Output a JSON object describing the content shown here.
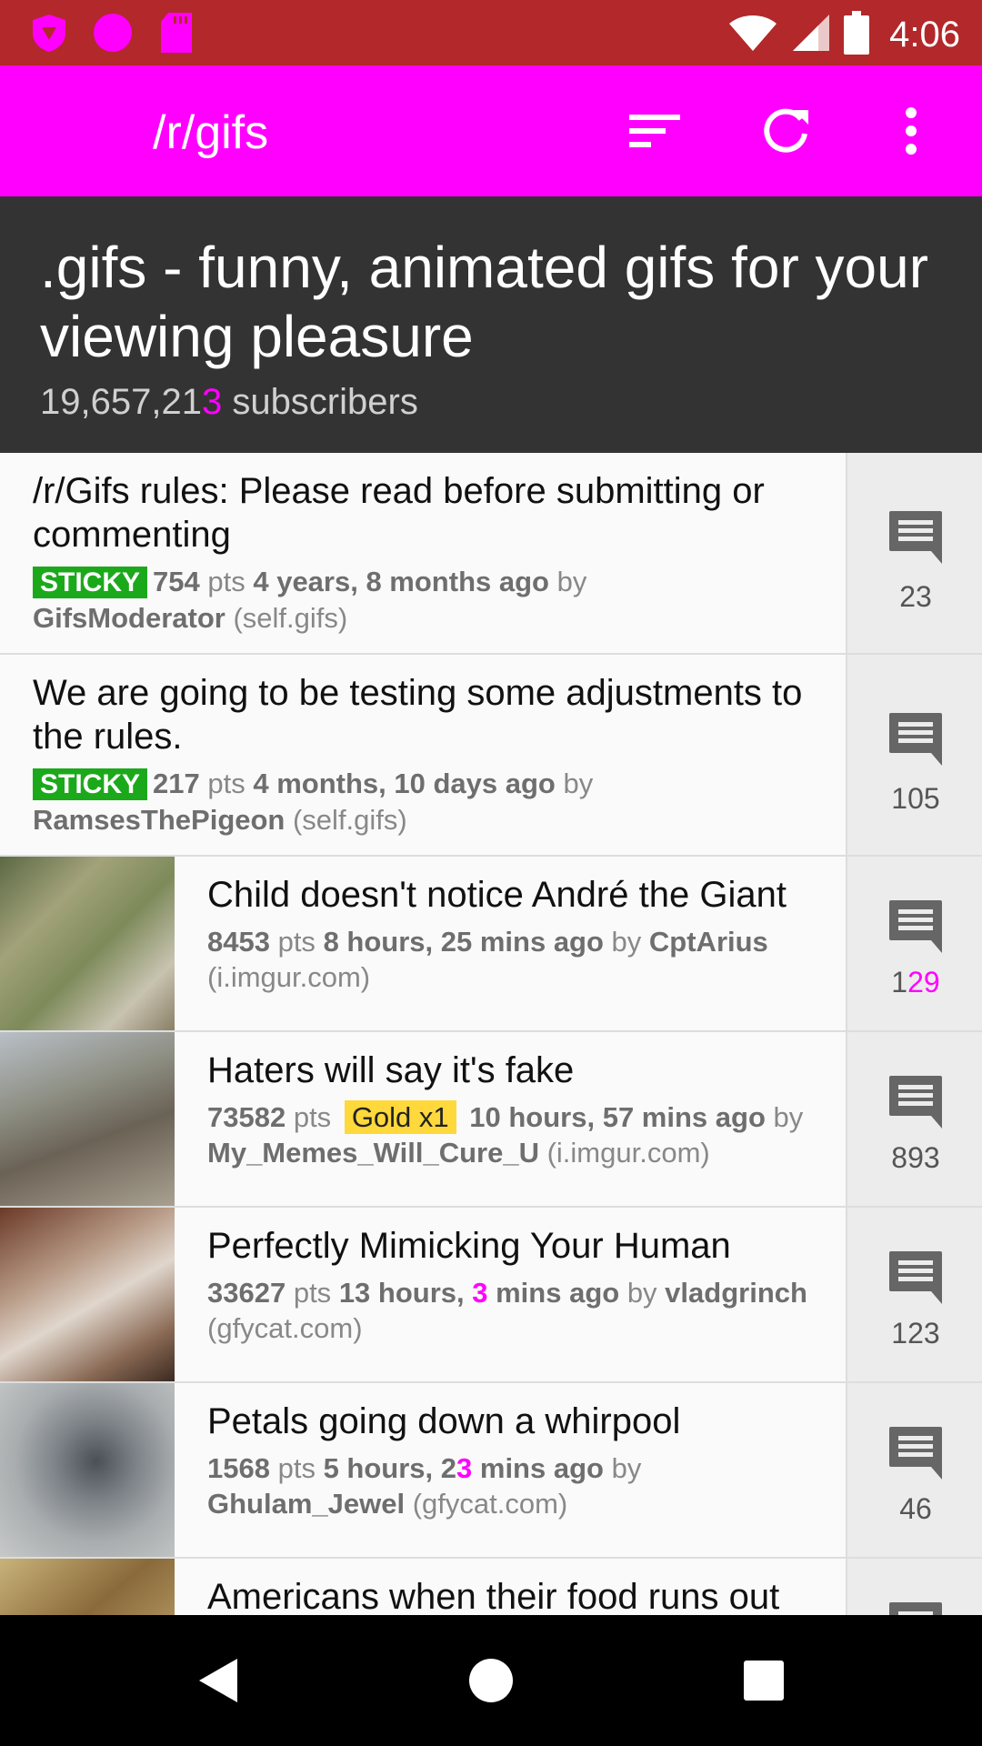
{
  "status_bar": {
    "time": "4:06",
    "left_icons": [
      "shield-icon",
      "circle-icon",
      "sd-card-icon"
    ],
    "right_icons": [
      "wifi-icon",
      "signal-icon",
      "battery-icon"
    ]
  },
  "app_bar": {
    "title": "/r/gifs",
    "actions": [
      "sort-icon",
      "refresh-icon",
      "more-vert-icon"
    ]
  },
  "subreddit": {
    "description": ".gifs - funny, animated gifs for your viewing pleasure",
    "subscribers_prefix": "19,657,21",
    "subscribers_glitch": "3",
    "subscribers_suffix": " subscribers"
  },
  "posts": [
    {
      "title": "/r/Gifs rules: Please read before submitting or commenting",
      "sticky": "STICKY",
      "pts_a": "75",
      "pts_b": "4",
      "pts_label": " pts ",
      "age": "4 years, 8 months ago",
      "by": " by ",
      "author": "GifsModerator",
      "domain": " (self.gifs)",
      "comments": "23"
    },
    {
      "title": "We are going to be testing some adjustments to the rules.",
      "sticky": "STICKY",
      "pts_a": "21",
      "pts_b": "7",
      "pts_label": " pts ",
      "age": "4 months, 10 days ago",
      "by": " by ",
      "author": "RamsesThePigeon",
      "domain": " (self.gifs)",
      "comments": "105"
    },
    {
      "title": "Child doesn't notice André the Giant",
      "pts_a": "84",
      "pts_b": "53",
      "pts_label": " pts ",
      "age": "8 hours, 25 mins ago",
      "by": " by ",
      "author": "CptArius",
      "domain": "(i.imgur.com)",
      "comments_a": "1",
      "comments_b": "29"
    },
    {
      "title": "Haters will say it's fake",
      "pts_a": "735",
      "pts_b": "82",
      "pts_label": " pts ",
      "gold": "Gold x1",
      "age": "10 hours, 57 mins ago",
      "by": " by",
      "author": "My_Memes_Will_Cure_U",
      "domain": " (i.imgur.com)",
      "comments": "893"
    },
    {
      "title": "Perfectly Mimicking Your Human",
      "pts_a": "3362",
      "pts_b": "7",
      "pts_label": " pts ",
      "age_a": "13 hours, ",
      "age_b": "3",
      "age_c": " mins ago",
      "by": " by ",
      "author": "vladgrinch",
      "domain": "(gfycat.com)",
      "comments": "123"
    },
    {
      "title": "Petals going down a whirpool",
      "pts_a": "156",
      "pts_b": "8",
      "pts_label": " pts ",
      "age_a": "5 hours, 2",
      "age_b": "3",
      "age_c": " mins ago",
      "by": " by",
      "author": "Ghulam_Jewel",
      "domain": " (gfycat.com)",
      "comments": "46"
    },
    {
      "title": "Americans when their food runs out"
    }
  ],
  "nav_bar": [
    "back-icon",
    "home-icon",
    "recents-icon"
  ],
  "colors": {
    "status_bar": "#b3282a",
    "app_bar": "#ff00ff",
    "header": "#333333",
    "sticky": "#1ba91b",
    "gold": "#ffd83b",
    "glitch": "#ff00ff"
  }
}
